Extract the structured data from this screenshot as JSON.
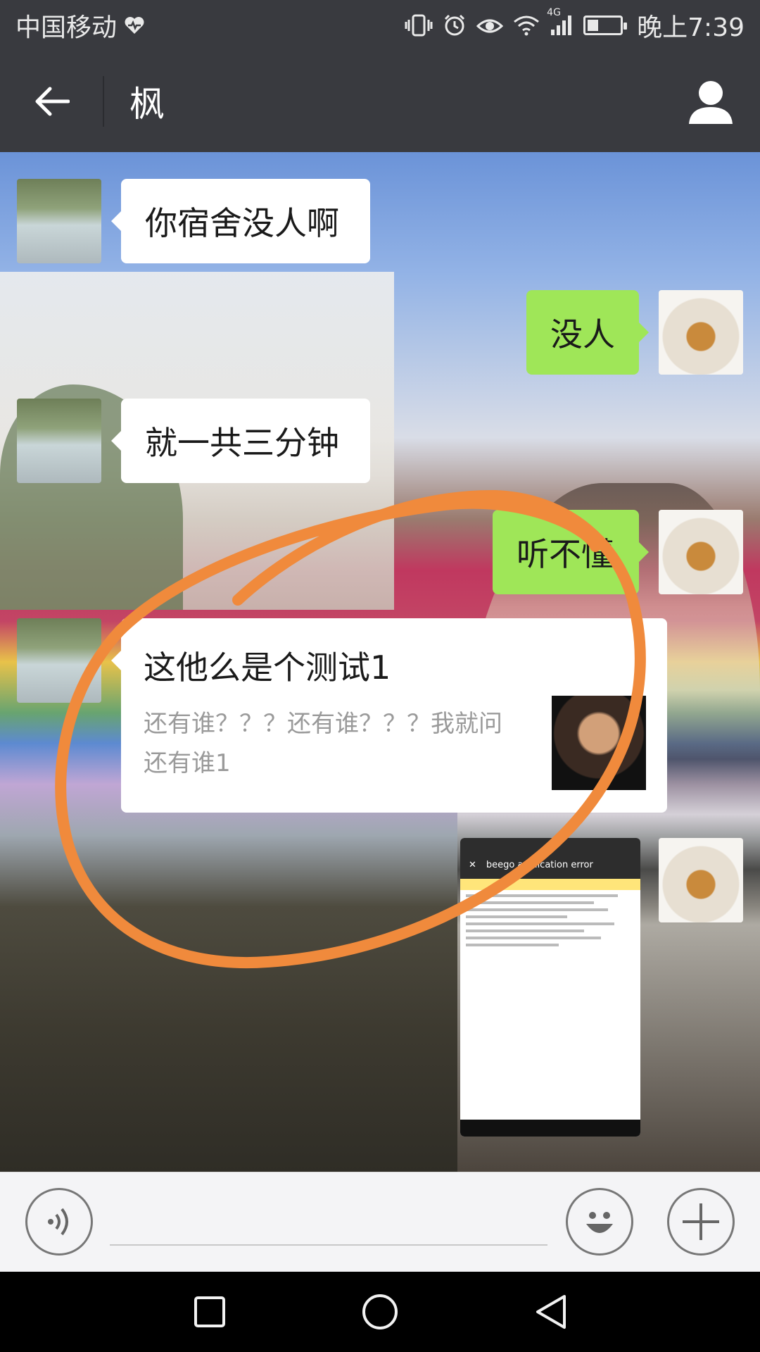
{
  "status_bar": {
    "carrier": "中国移动",
    "network": "4G",
    "time": "晚上7:39",
    "battery_level": 0.35,
    "icons": [
      "heartbeat-icon",
      "vibrate-icon",
      "alarm-icon",
      "eye-icon",
      "wifi-icon",
      "signal-icon",
      "battery-icon"
    ]
  },
  "header": {
    "title": "枫",
    "icons": [
      "back-arrow-icon",
      "person-icon"
    ]
  },
  "messages": [
    {
      "side": "left",
      "type": "text",
      "text": "你宿舍没人啊"
    },
    {
      "side": "right",
      "type": "text",
      "text": "没人"
    },
    {
      "side": "left",
      "type": "text",
      "text": "就一共三分钟"
    },
    {
      "side": "right",
      "type": "text",
      "text": "听不懂"
    },
    {
      "side": "left",
      "type": "card",
      "title": "这他么是个测试1",
      "description": "还有谁？？？还有谁？？？我就问还有谁1"
    },
    {
      "side": "right",
      "type": "image",
      "caption": "beego application error"
    }
  ],
  "input_bar": {
    "placeholder": "",
    "icons": [
      "voice-icon",
      "emoji-icon",
      "plus-icon"
    ]
  },
  "nav_bar": {
    "icons": [
      "recent-apps-icon",
      "home-icon",
      "back-triangle-icon"
    ]
  },
  "colors": {
    "bar_background": "#393a3f",
    "sent_bubble": "#9fe658",
    "received_bubble": "#ffffff",
    "annotation": "#f08a3c"
  }
}
